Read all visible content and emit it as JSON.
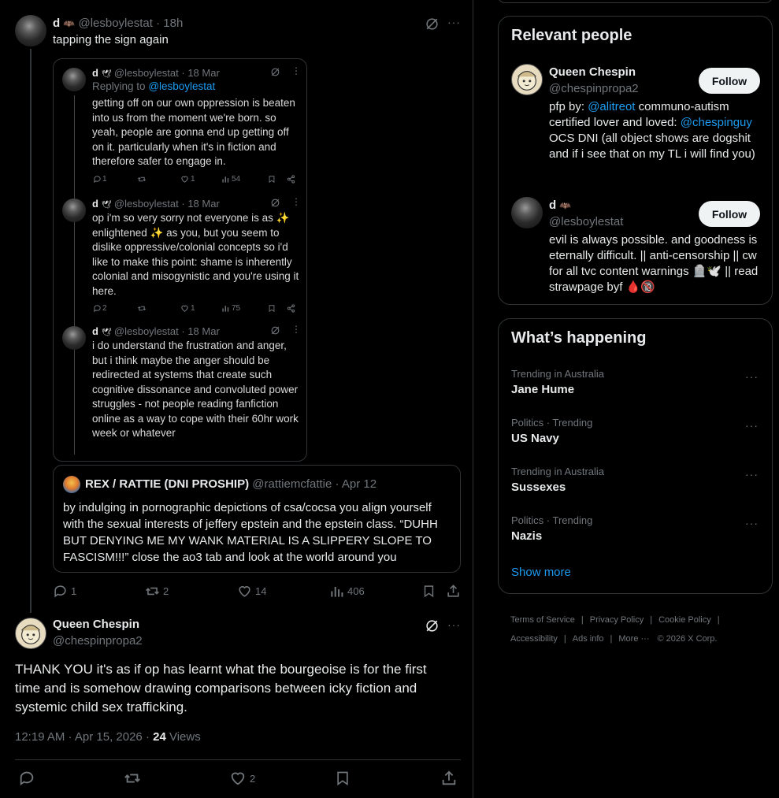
{
  "tweet1": {
    "name": "d",
    "badge": "🦇",
    "handle": "@lesboylestat",
    "time": "· 18h",
    "text": "tapping the sign again",
    "stats": {
      "replies": "1",
      "retweets": "2",
      "likes": "14",
      "views": "406"
    }
  },
  "embedded": {
    "posts": [
      {
        "name": "d",
        "badge": "🕊",
        "handle": "@lesboylestat",
        "time": "· 18 Mar",
        "replying_label": "Replying to",
        "replying_to": "@lesboylestat",
        "text": "getting off on our own oppression is beaten into us from the moment we're born. so yeah, people are gonna end up getting off on it. particularly when it's in fiction and therefore safer to engage in.",
        "replies": "1",
        "retweets": "",
        "likes": "1",
        "views": "54"
      },
      {
        "name": "d",
        "badge": "🕊",
        "handle": "@lesboylestat",
        "time": "· 18 Mar",
        "text": "op i'm so very sorry not everyone is as ✨ enlightened ✨ as you, but you seem to dislike oppressive/colonial concepts so i'd like to make this point: shame is inherently colonial and misogynistic and you're using it here.",
        "replies": "2",
        "retweets": "",
        "likes": "1",
        "views": "75"
      },
      {
        "name": "d",
        "badge": "🕊",
        "handle": "@lesboylestat",
        "time": "· 18 Mar",
        "text": "i do understand the frustration and anger, but i think maybe the anger should be redirected at systems that create such cognitive dissonance and convoluted power struggles - not people reading fanfiction online as a way to cope with their 60hr work week or whatever"
      }
    ]
  },
  "quote": {
    "name": "REX / RATTIE (DNI PROSHIP)",
    "handle": "@rattiemcfattie",
    "time": "· Apr 12",
    "text": "by indulging in pornographic depictions of csa/cocsa you align yourself with the sexual interests of jeffery epstein and the epstein class. “DUHH BUT DENYING ME MY WANK MATERIAL IS A SLIPPERY SLOPE TO FASCISM!!!” close the ao3 tab and look at the world around you"
  },
  "main_tweet": {
    "name": "Queen Chespin",
    "handle": "@chespinpropa2",
    "text": "THANK YOU it's as if op has learnt what the bourgeoise is for the first time and is somehow drawing comparisons between icky fiction and systemic child sex trafficking.",
    "timestamp": "12:19 AM · Apr 15, 2026 ·",
    "views_count": "24",
    "views_label": "Views",
    "likes": "2"
  },
  "relevant": {
    "title": "Relevant people",
    "people": [
      {
        "name": "Queen Chespin",
        "handle": "@chespinpropa2",
        "follow": "Follow",
        "bio_1": "pfp by: ",
        "bio_link1": "@alitreot",
        "bio_2": " communo-autism certified lover and loved: ",
        "bio_link2": "@chespinguy",
        "bio_3": " OCS DNI (all object shows are dogshit and if i see that on my TL i will find you)"
      },
      {
        "name": "d",
        "badge": "🦇",
        "handle": "@lesboylestat",
        "follow": "Follow",
        "bio": "evil is always possible. and goodness is eternally difficult. || anti-censorship || cw for all tvc content warnings 🪦🕊️ || read strawpage byf 🩸🔞"
      }
    ]
  },
  "happening": {
    "title": "What’s happening",
    "items": [
      {
        "context": "Trending in Australia",
        "topic": "Jane Hume"
      },
      {
        "context": "Politics · Trending",
        "topic": "US Navy"
      },
      {
        "context": "Trending in Australia",
        "topic": "Sussexes"
      },
      {
        "context": "Politics · Trending",
        "topic": "Nazis"
      }
    ],
    "show_more": "Show more"
  },
  "footer": {
    "terms": "Terms of Service",
    "privacy": "Privacy Policy",
    "cookie": "Cookie Policy",
    "accessibility": "Accessibility",
    "ads": "Ads info",
    "more": "More ···",
    "copyright": "© 2026 X Corp."
  }
}
